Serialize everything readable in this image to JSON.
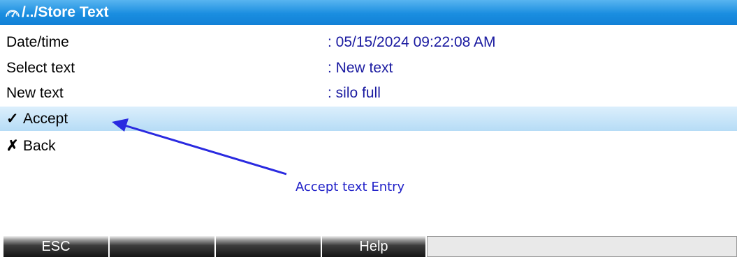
{
  "header": {
    "title": "/../Store Text",
    "icon": "gauge-icon",
    "background_color": "#1a8ee0"
  },
  "fields": [
    {
      "label": "Date/time",
      "value": ": 05/15/2024 09:22:08 AM"
    },
    {
      "label": "Select text",
      "value": ": New text"
    },
    {
      "label": "New text",
      "value": ": silo full"
    }
  ],
  "actions": [
    {
      "label": "Accept",
      "mark": "✓",
      "icon": "checkmark-icon",
      "selected": true
    },
    {
      "label": "Back",
      "mark": "✗",
      "icon": "cross-icon",
      "selected": false
    }
  ],
  "annotation": {
    "text": "Accept text Entry",
    "color": "#2020c8"
  },
  "softkeys": [
    {
      "label": "ESC"
    },
    {
      "label": ""
    },
    {
      "label": ""
    },
    {
      "label": "Help"
    }
  ],
  "colors": {
    "value_text": "#1a1aa0",
    "selected_row": "#c8e6fa"
  }
}
